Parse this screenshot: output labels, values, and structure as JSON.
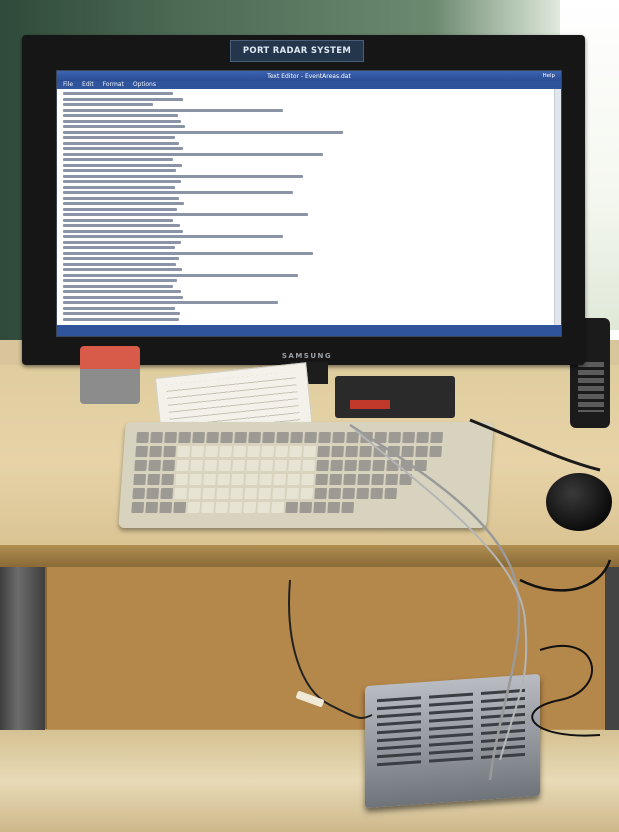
{
  "sign": {
    "text": "PORT RADAR SYSTEM"
  },
  "monitor": {
    "brand": "SAMSUNG"
  },
  "editor": {
    "window_title": "Text Editor - EventAreas.dat",
    "help_label": "Help",
    "menu": [
      "File",
      "Edit",
      "Format",
      "Options"
    ]
  },
  "colors": {
    "titlebar": "#2a4c91",
    "sign_plate": "#24364c",
    "stapler_red": "#d85b4a",
    "desk": "#e0cd9f"
  }
}
